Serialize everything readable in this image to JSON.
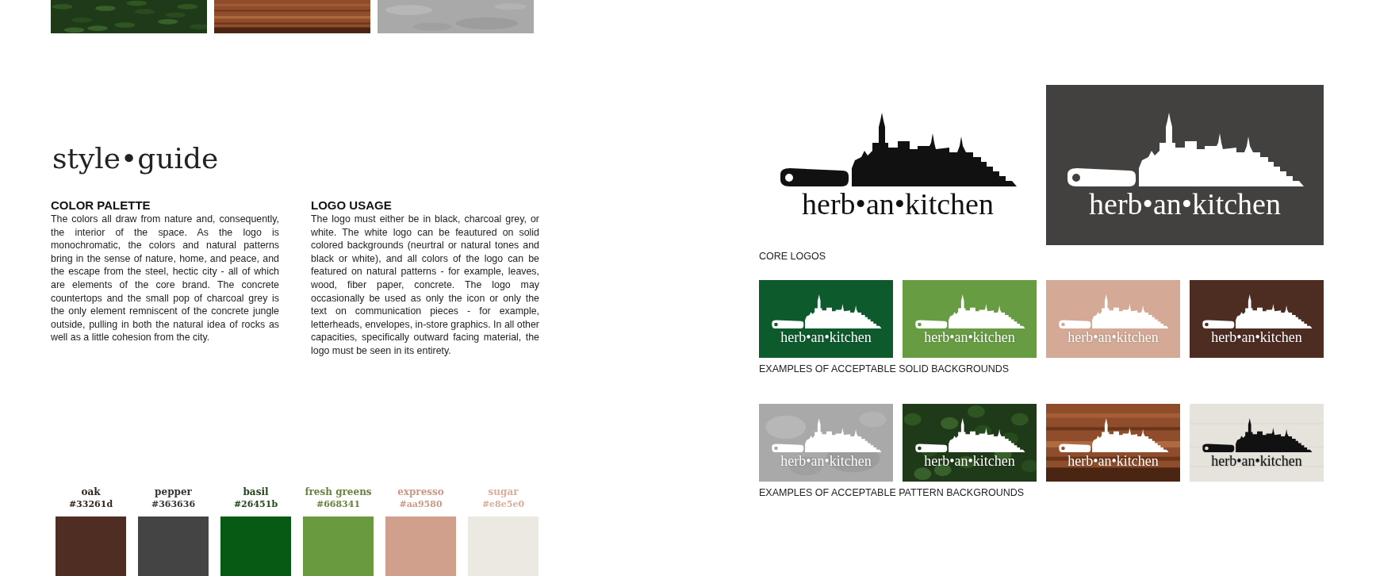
{
  "title": "style•guide",
  "sections": [
    {
      "heading": "COLOR PALETTE",
      "body": "The colors all draw from nature and, consequently, the interior of the space. As the logo is monochromatic, the colors and natural patterns bring in the sense of nature, home, and peace, and the escape from the steel, hectic city - all of which are elements of the core brand. The concrete countertops and the small pop of charcoal grey is the only element remniscent of the concrete jungle outside, pulling in both the natural idea of rocks as well as a little cohesion from the city."
    },
    {
      "heading": "LOGO USAGE",
      "body": "The logo must either be in black, charcoal grey, or white. The white logo can be feautured on solid colored backgrounds (neurtral or natural tones and black or white), and all colors of the logo can be featured on natural patterns - for example, leaves, wood, fiber paper, concrete. The logo may occasionally be used as only the icon or only the text on communication pieces - for example, letterheads, envelopes, in-store graphics. In all other capacities, specifically outward facing material, the logo must be seen in its entirety."
    }
  ],
  "palette": [
    {
      "name": "oak",
      "hex": "#33261d",
      "color": "#502d22"
    },
    {
      "name": "pepper",
      "hex": "#363636",
      "color": "#444444"
    },
    {
      "name": "basil",
      "hex": "#26451b",
      "color": "#065a14"
    },
    {
      "name": "fresh greens",
      "hex": "#668341",
      "color": "#6a9a40"
    },
    {
      "name": "expresso",
      "hex": "#aa9580",
      "color": "#d0a08c"
    },
    {
      "name": "sugar",
      "hex": "#e8e5e0",
      "color": "#ece8e2"
    }
  ],
  "core_logos": {
    "caption": "CORE LOGOS",
    "items": [
      {
        "kind": "plain",
        "white_logo": false,
        "text": "herb•an•kitchen"
      },
      {
        "kind": "solid",
        "color": "#434140",
        "white_logo": true,
        "text": "herb•an•kitchen"
      }
    ]
  },
  "solid_examples": {
    "caption": "EXAMPLES OF ACCEPTABLE SOLID BACKGROUNDS",
    "items": [
      {
        "kind": "solid",
        "color": "#0d5a2c",
        "white_logo": true,
        "text": "herb•an•kitchen"
      },
      {
        "kind": "solid",
        "color": "#679c43",
        "white_logo": true,
        "text": "herb•an•kitchen"
      },
      {
        "kind": "solid",
        "color": "#d4a995",
        "white_logo": true,
        "text": "herb•an•kitchen"
      },
      {
        "kind": "solid",
        "color": "#4d2c22",
        "white_logo": true,
        "text": "herb•an•kitchen"
      }
    ]
  },
  "pattern_examples": {
    "caption": "EXAMPLES OF ACCEPTABLE PATTERN BACKGROUNDS",
    "items": [
      {
        "kind": "pattern",
        "white_logo": true,
        "text": "herb•an•kitchen"
      },
      {
        "kind": "pattern",
        "white_logo": true,
        "text": "herb•an•kitchen"
      },
      {
        "kind": "pattern",
        "white_logo": true,
        "text": "herb•an•kitchen"
      },
      {
        "kind": "pattern",
        "white_logo": false,
        "text": "herb•an•kitchen"
      }
    ]
  }
}
